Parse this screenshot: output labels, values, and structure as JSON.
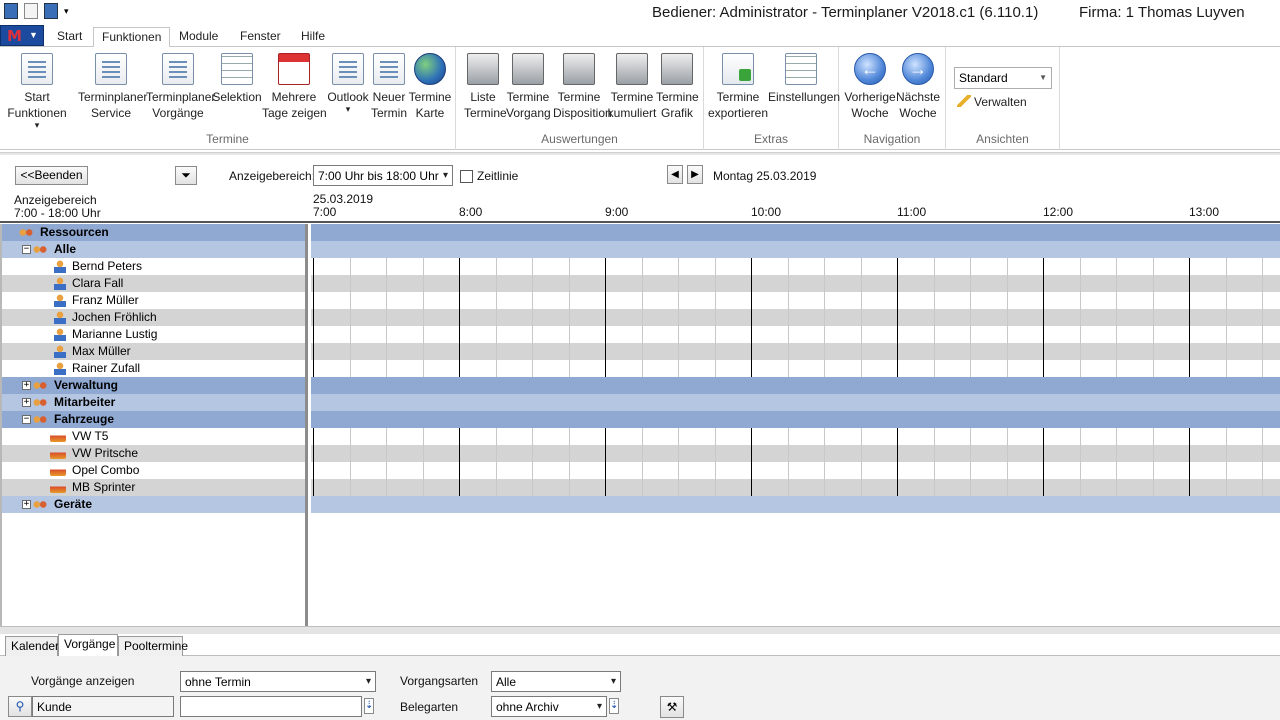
{
  "window": {
    "title": "Bediener: Administrator - Terminplaner   V2018.c1 (6.110.1)",
    "firma": "Firma: 1   Thomas Luyven"
  },
  "menu_tabs": [
    "Start",
    "Funktionen",
    "Module",
    "Fenster",
    "Hilfe"
  ],
  "active_tab": "Funktionen",
  "ribbon": {
    "groups": [
      {
        "name": "Termine",
        "buttons": [
          {
            "label": "Start\nFunktionen",
            "icon": "document-list-icon",
            "dropdown": true
          },
          {
            "label": "Terminplaner\nService",
            "icon": "service-list-icon"
          },
          {
            "label": "Terminplaner\nVorgänge",
            "icon": "vorgaenge-list-icon"
          },
          {
            "label": "Selektion",
            "icon": "selection-grid-icon"
          },
          {
            "label": "Mehrere\nTage zeigen",
            "icon": "calendar-icon"
          },
          {
            "label": "Outlook",
            "icon": "outlook-icon",
            "dropdown": true
          },
          {
            "label": "Neuer\nTermin",
            "icon": "new-appointment-icon"
          },
          {
            "label": "Termine\nKarte",
            "icon": "globe-map-icon"
          }
        ]
      },
      {
        "name": "Auswertungen",
        "buttons": [
          {
            "label": "Liste\nTermine",
            "icon": "printer-icon"
          },
          {
            "label": "Termine\nVorgang",
            "icon": "printer-icon"
          },
          {
            "label": "Termine\nDisposition",
            "icon": "printer-icon"
          },
          {
            "label": "Termine\nkumuliert",
            "icon": "printer-icon"
          },
          {
            "label": "Termine\nGrafik",
            "icon": "printer-icon"
          }
        ]
      },
      {
        "name": "Extras",
        "buttons": [
          {
            "label": "Termine\nexportieren",
            "icon": "export-icon"
          },
          {
            "label": "Einstellungen",
            "icon": "settings-grid-icon"
          }
        ]
      },
      {
        "name": "Navigation",
        "buttons": [
          {
            "label": "Vorherige\nWoche",
            "icon": "arrow-left-icon"
          },
          {
            "label": "Nächste\nWoche",
            "icon": "arrow-right-icon"
          }
        ]
      },
      {
        "name": "Ansichten",
        "select_value": "Standard",
        "link": "Verwalten"
      }
    ]
  },
  "toolbar": {
    "back_button": "<<Beenden",
    "range_label": "Anzeigebereich:",
    "range_value": "7:00 Uhr bis 18:00 Uhr",
    "zeitlinie_label": "Zeitlinie",
    "date_label": "Montag 25.03.2019"
  },
  "time_header": {
    "range_title": "Anzeigebereich",
    "range_text": "7:00 - 18:00 Uhr",
    "date": "25.03.2019",
    "hours": [
      "7:00",
      "8:00",
      "9:00",
      "10:00",
      "11:00",
      "12:00",
      "13:00"
    ]
  },
  "resources": [
    {
      "type": "group",
      "level": 0,
      "label": "Ressourcen"
    },
    {
      "type": "group",
      "level": 1,
      "label": "Alle",
      "toggle": "-"
    },
    {
      "type": "person",
      "label": "Bernd Peters"
    },
    {
      "type": "person",
      "label": "Clara Fall"
    },
    {
      "type": "person",
      "label": "Franz Müller"
    },
    {
      "type": "person",
      "label": "Jochen Fröhlich"
    },
    {
      "type": "person",
      "label": "Marianne Lustig"
    },
    {
      "type": "person",
      "label": "Max Müller"
    },
    {
      "type": "person",
      "label": "Rainer Zufall"
    },
    {
      "type": "group",
      "level": 0,
      "label": "Verwaltung",
      "toggle": "+"
    },
    {
      "type": "group",
      "level": 1,
      "label": "Mitarbeiter",
      "toggle": "+"
    },
    {
      "type": "group",
      "level": 0,
      "label": "Fahrzeuge",
      "toggle": "-"
    },
    {
      "type": "car",
      "label": "VW T5"
    },
    {
      "type": "car",
      "label": "VW Pritsche"
    },
    {
      "type": "car",
      "label": "Opel Combo"
    },
    {
      "type": "car",
      "label": "MB Sprinter"
    },
    {
      "type": "group",
      "level": 1,
      "label": "Geräte",
      "toggle": "+"
    }
  ],
  "bottom_tabs": [
    "Kalender",
    "Vorgänge",
    "Pooltermine"
  ],
  "bottom_active": "Vorgänge",
  "bottom_panel": {
    "vorgaenge_label": "Vorgänge anzeigen",
    "vorgaenge_value": "ohne Termin",
    "vorgangsarten_label": "Vorgangsarten",
    "vorgangsarten_value": "Alle",
    "kunde_placeholder": "Kunde",
    "kunde_value": "",
    "belegarten_label": "Belegarten",
    "belegarten_value": "ohne Archiv"
  }
}
